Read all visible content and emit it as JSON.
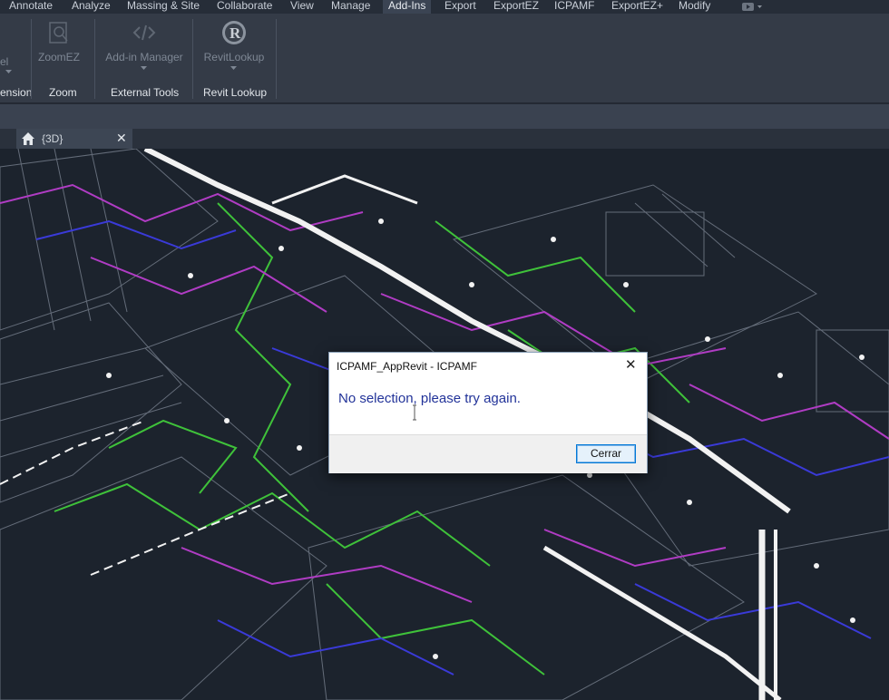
{
  "menu": {
    "tabs": [
      "Annotate",
      "Analyze",
      "Massing & Site",
      "Collaborate",
      "View",
      "Manage",
      "Add-Ins",
      "Export",
      "ExportEZ",
      "ICPAMF",
      "ExportEZ+",
      "Modify"
    ],
    "active": "Add-Ins"
  },
  "ribbon": {
    "cutoff_left_button": "el",
    "zoom_button": "ZoomEZ",
    "addin_button": "Add-in Manager",
    "lookup_button": "RevitLookup",
    "panels": {
      "extension": "ension",
      "zoom": "Zoom",
      "external_tools": "External Tools",
      "revit_lookup": "Revit Lookup"
    }
  },
  "view_tab": {
    "label": "{3D}"
  },
  "dialog": {
    "title": "ICPAMF_AppRevit - ICPAMF",
    "message": "No selection, please try again.",
    "button": "Cerrar"
  },
  "colors": {
    "accent": "#0078d7",
    "pipe_green": "#3fc23a",
    "pipe_magenta": "#b03cc4",
    "pipe_blue": "#3a3ad8",
    "pipe_white": "#f2f2f2"
  }
}
